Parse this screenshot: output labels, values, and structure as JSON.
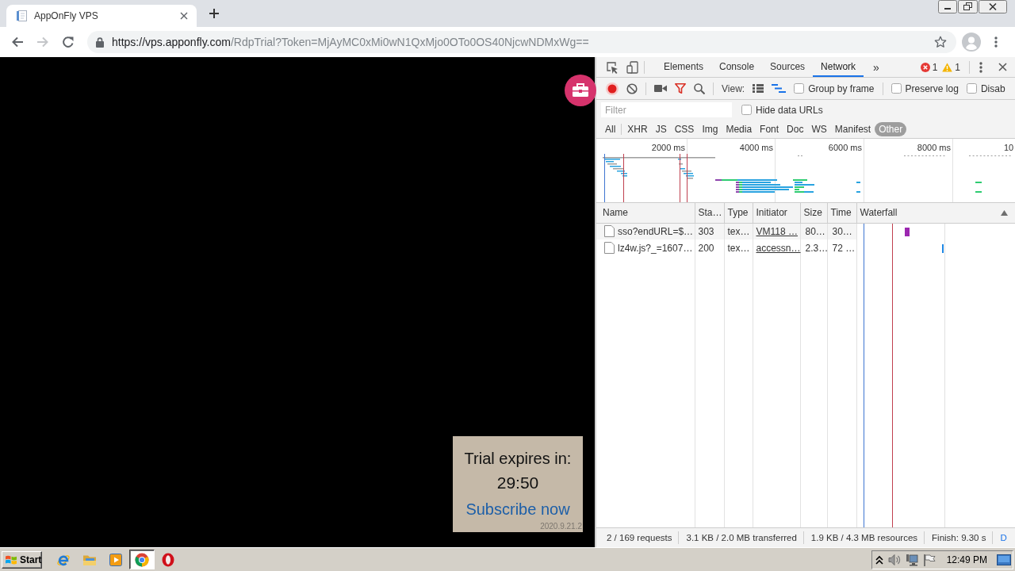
{
  "browser": {
    "tab": {
      "title": "AppOnFly VPS"
    },
    "nav": [
      {
        "kind": "back",
        "disabled": false
      },
      {
        "kind": "forward",
        "disabled": true
      },
      {
        "kind": "reload",
        "disabled": false
      }
    ],
    "address": {
      "host": "https://vps.apponfly.com",
      "path": "/RdpTrial?Token=MjAyMC0xMi0wN1QxMjo0OTo0OS40NjcwNDMxWg=="
    }
  },
  "page": {
    "trial": {
      "heading": "Trial expires in:",
      "countdown": "29:50",
      "link": "Subscribe now",
      "version": "2020.9.21.2"
    }
  },
  "devtools": {
    "tabs": [
      {
        "label": "Elements",
        "selected": false
      },
      {
        "label": "Console",
        "selected": false
      },
      {
        "label": "Sources",
        "selected": false
      },
      {
        "label": "Network",
        "selected": true
      }
    ],
    "more": "»",
    "errors": "1",
    "warnings": "1",
    "toolbar": {
      "recording": true,
      "filter_on": true,
      "view_label": "View:",
      "view_toggles": [
        {
          "kind": "large-rows",
          "on": false
        },
        {
          "kind": "overview",
          "on": true
        }
      ],
      "options": [
        {
          "label": "Group by frame",
          "checked": false
        },
        {
          "label": "Preserve log",
          "checked": false
        },
        {
          "label": "Disab",
          "checked": false
        }
      ]
    },
    "filter": {
      "placeholder": "Filter",
      "option": {
        "label": "Hide data URLs",
        "checked": false
      }
    },
    "types": [
      {
        "label": "All",
        "selected": false
      },
      {
        "label": "XHR",
        "selected": false
      },
      {
        "label": "JS",
        "selected": false
      },
      {
        "label": "CSS",
        "selected": false
      },
      {
        "label": "Img",
        "selected": false
      },
      {
        "label": "Media",
        "selected": false
      },
      {
        "label": "Font",
        "selected": false
      },
      {
        "label": "Doc",
        "selected": false
      },
      {
        "label": "WS",
        "selected": false
      },
      {
        "label": "Manifest",
        "selected": false
      },
      {
        "label": "Other",
        "selected": true
      }
    ],
    "overview": {
      "ticks": [
        "2000 ms",
        "4000 ms",
        "6000 ms",
        "8000 ms",
        "10"
      ]
    },
    "table": {
      "columns": [
        "Name",
        "Sta…",
        "Type",
        "Initiator",
        "Size",
        "Time",
        "Waterfall"
      ],
      "rows": [
        {
          "name": "sso?endURL=$…",
          "status": "303",
          "type": "tex…",
          "initiator": "VM118 …",
          "size": "80…",
          "time": "30…"
        },
        {
          "name": "lz4w.js?_=1607…",
          "status": "200",
          "type": "tex…",
          "initiator": "accessn…",
          "size": "2.3…",
          "time": "72 …"
        }
      ]
    },
    "summary": [
      {
        "text": "2 / 169 requests",
        "kind": "text"
      },
      {
        "text": "3.1 KB / 2.0 MB transferred",
        "kind": "text"
      },
      {
        "text": "1.9 KB / 4.3 MB resources",
        "kind": "text"
      },
      {
        "text": "Finish: 9.30 s",
        "kind": "text"
      },
      {
        "text": "D",
        "kind": "link"
      }
    ]
  },
  "taskbar": {
    "start": "Start",
    "apps": [
      {
        "kind": "ie",
        "selected": false
      },
      {
        "kind": "folder",
        "selected": false
      },
      {
        "kind": "media",
        "selected": false
      },
      {
        "kind": "chrome",
        "selected": true
      },
      {
        "kind": "opera",
        "selected": false
      }
    ],
    "clock": "12:49 PM"
  }
}
